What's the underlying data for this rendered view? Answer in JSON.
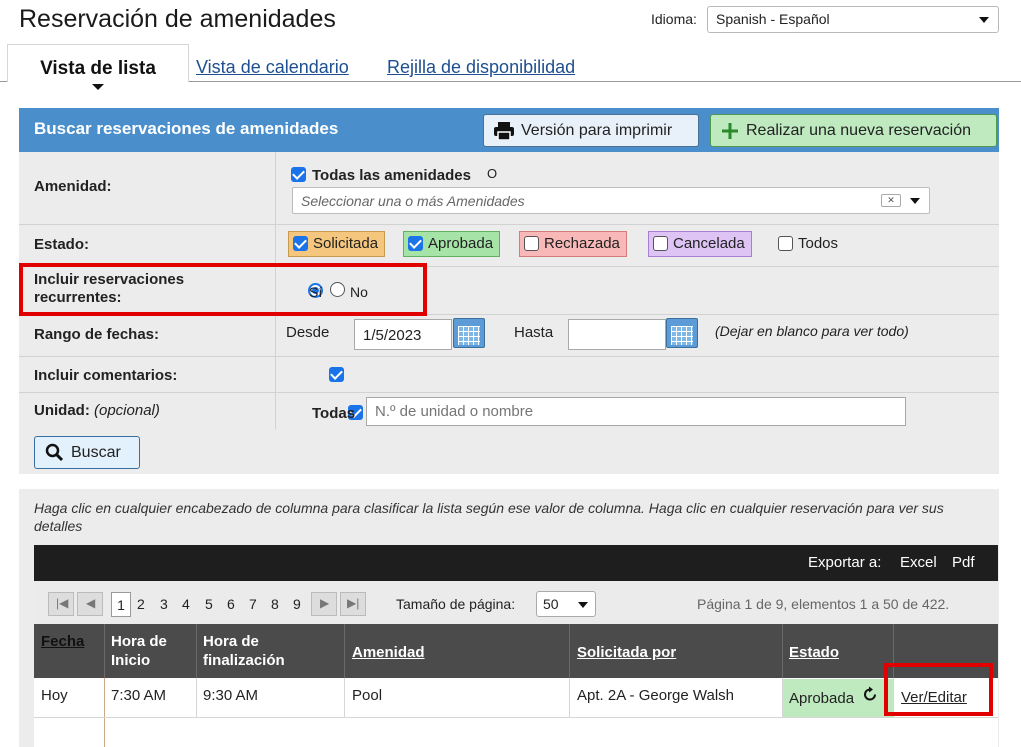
{
  "header": {
    "title": "Reservación de amenidades",
    "language_label": "Idioma:",
    "language_value": "Spanish - Español"
  },
  "tabs": [
    {
      "label": "Vista de lista",
      "active": true
    },
    {
      "label": "Vista de calendario",
      "active": false
    },
    {
      "label": "Rejilla de disponibilidad",
      "active": false
    }
  ],
  "search": {
    "title": "Buscar reservaciones de amenidades",
    "print_button": "Versión para imprimir",
    "new_button": "Realizar una nueva reservación",
    "amenity": {
      "label": "Amenidad:",
      "all_label": "Todas las amenidades",
      "all_checked": true,
      "marker": "O",
      "placeholder": "Seleccionar una o más Amenidades"
    },
    "status": {
      "label": "Estado:",
      "options": [
        {
          "label": "Solicitada",
          "checked": true,
          "color": "#f5c77e"
        },
        {
          "label": "Aprobada",
          "checked": true,
          "color": "#a6e3a6"
        },
        {
          "label": "Rechazada",
          "checked": false,
          "color": "#f8b8b8"
        },
        {
          "label": "Cancelada",
          "checked": false,
          "color": "#ddc4f5"
        },
        {
          "label": "Todos",
          "checked": false,
          "color": ""
        }
      ]
    },
    "recurring": {
      "label": "Incluir reservaciones recurrentes:",
      "yes": "Sí",
      "no": "No",
      "selected": "Sí"
    },
    "date_range": {
      "label": "Rango de fechas:",
      "from_label": "Desde",
      "from_value": "1/5/2023",
      "to_label": "Hasta",
      "to_value": "",
      "hint": "(Dejar en blanco para ver todo)"
    },
    "comments": {
      "label": "Incluir comentarios:",
      "checked": true
    },
    "unit": {
      "label": "Unidad:",
      "optional": "(opcional)",
      "all_label": "Todas",
      "all_checked": true,
      "placeholder": "N.º de unidad o nombre"
    },
    "search_button": "Buscar"
  },
  "results": {
    "help_text": "Haga clic en cualquier encabezado de columna para clasificar la lista según ese valor de columna. Haga clic en cualquier reservación para ver sus detalles",
    "export_label": "Exportar a:",
    "export_excel": "Excel",
    "export_pdf": "Pdf",
    "pager": {
      "pages": [
        "1",
        "2",
        "3",
        "4",
        "5",
        "6",
        "7",
        "8",
        "9"
      ],
      "current": "1",
      "page_size_label": "Tamaño de página:",
      "page_size": "50",
      "info": "Página 1 de 9, elementos 1 a 50 de 422."
    },
    "columns": [
      "Fecha",
      "Hora de Inicio",
      "Hora de finalización",
      "Amenidad",
      "Solicitada por",
      "Estado"
    ],
    "column_lines": [
      [
        "Fecha"
      ],
      [
        "Hora de",
        "Inicio"
      ],
      [
        "Hora de",
        "finalización"
      ],
      [
        "Amenidad"
      ],
      [
        "Solicitada por"
      ],
      [
        "Estado"
      ]
    ],
    "rows": [
      {
        "date": "Hoy",
        "start": "7:30 AM",
        "end": "9:30 AM",
        "amenity": "Pool",
        "requested_by": "Apt. 2A - George Walsh",
        "status": "Aprobada",
        "action": "Ver/Editar"
      }
    ]
  },
  "colors": {
    "panel_header": "#4a8fcb",
    "highlight": "#e00000",
    "approved": "#bfe9bf"
  }
}
